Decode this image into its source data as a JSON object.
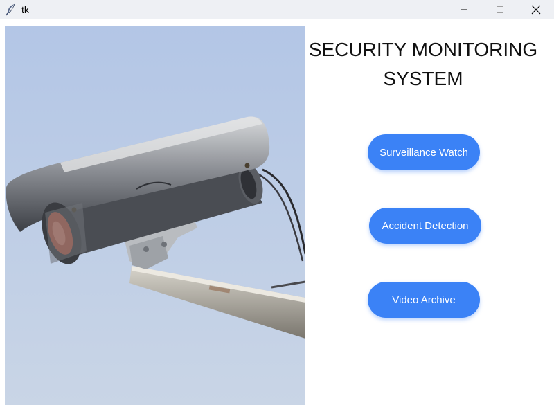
{
  "window": {
    "title": "tk",
    "icons": {
      "app": "feather-icon",
      "minimize": "minimize-icon",
      "maximize": "maximize-icon",
      "close": "close-icon"
    }
  },
  "main": {
    "heading_line1": "SECURITY MONITORING",
    "heading_line2": "SYSTEM",
    "buttons": [
      {
        "label": "Surveillance Watch"
      },
      {
        "label": "Accident Detection"
      },
      {
        "label": "Video Archive"
      }
    ],
    "image": "security-camera-photo"
  },
  "colors": {
    "button": "#3b82f6",
    "button_text": "#ffffff",
    "sky": "#b8cbe6",
    "titlebar": "#eef0f4"
  }
}
